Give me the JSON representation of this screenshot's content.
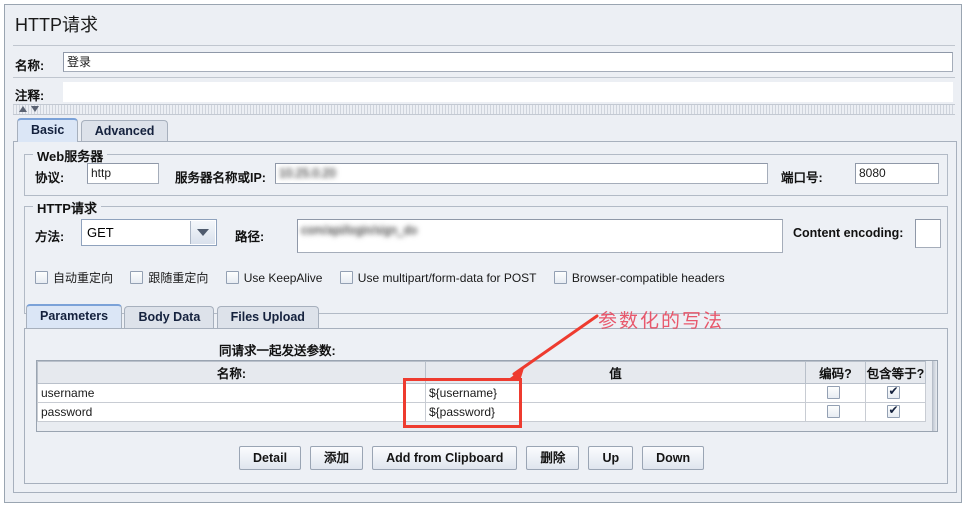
{
  "header": {
    "title": "HTTP请求",
    "name_label": "名称:",
    "name_value": "登录",
    "comment_label": "注释:",
    "comment_value": ""
  },
  "main_tabs": [
    {
      "label": "Basic",
      "selected": true
    },
    {
      "label": "Advanced",
      "selected": false
    }
  ],
  "web_server": {
    "group_title": "Web服务器",
    "protocol_label": "协议:",
    "protocol_value": "http",
    "server_label": "服务器名称或IP:",
    "server_value": "10.25.0.20",
    "port_label": "端口号:",
    "port_value": "8080"
  },
  "http_request": {
    "group_title": "HTTP请求",
    "method_label": "方法:",
    "method_value": "GET",
    "path_label": "路径:",
    "path_value": "com/api/login/sign_do",
    "content_encoding_label": "Content encoding:",
    "content_encoding_value": ""
  },
  "options": [
    {
      "label": "自动重定向",
      "checked": false
    },
    {
      "label": "跟随重定向",
      "checked": false
    },
    {
      "label": "Use KeepAlive",
      "checked": false
    },
    {
      "label": "Use multipart/form-data for POST",
      "checked": false
    },
    {
      "label": "Browser-compatible headers",
      "checked": false
    }
  ],
  "param_tabs": [
    {
      "label": "Parameters",
      "selected": true
    },
    {
      "label": "Body Data",
      "selected": false
    },
    {
      "label": "Files Upload",
      "selected": false
    }
  ],
  "parameters": {
    "section_title": "同请求一起发送参数:",
    "columns": [
      "名称:",
      "值",
      "编码?",
      "包含等于?"
    ],
    "rows": [
      {
        "name": "username",
        "value": "${username}",
        "encode": false,
        "include_equals": true
      },
      {
        "name": "password",
        "value": "${password}",
        "encode": false,
        "include_equals": true
      }
    ]
  },
  "buttons": [
    "Detail",
    "添加",
    "Add from Clipboard",
    "删除",
    "Up",
    "Down"
  ],
  "annotation": {
    "text": "参数化的写法",
    "color": "#ee3b2f"
  }
}
